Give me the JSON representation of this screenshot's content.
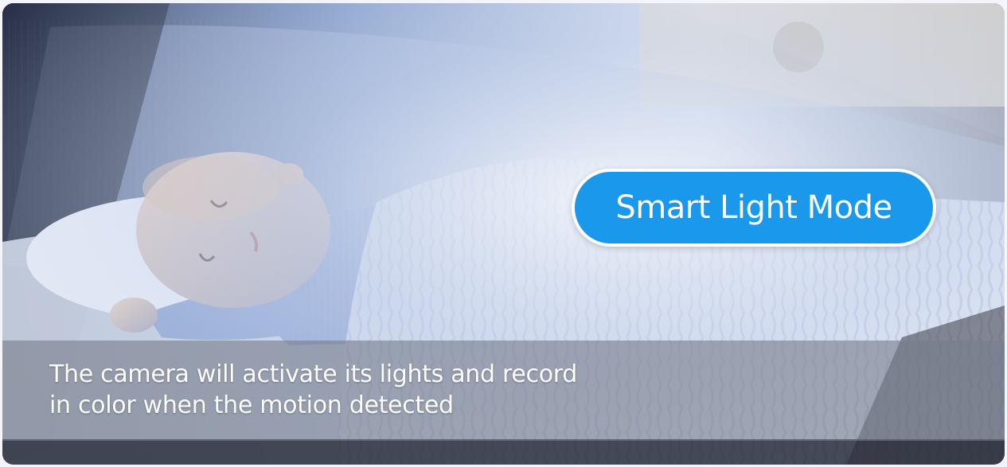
{
  "mode_button": {
    "label": "Smart Light Mode"
  },
  "caption": {
    "line1": "The camera will activate its lights and record",
    "line2": "in color when the motion detected"
  },
  "colors": {
    "accent": "#1a98ec",
    "text": "#ffffff",
    "caption_band": "#787e8c"
  }
}
